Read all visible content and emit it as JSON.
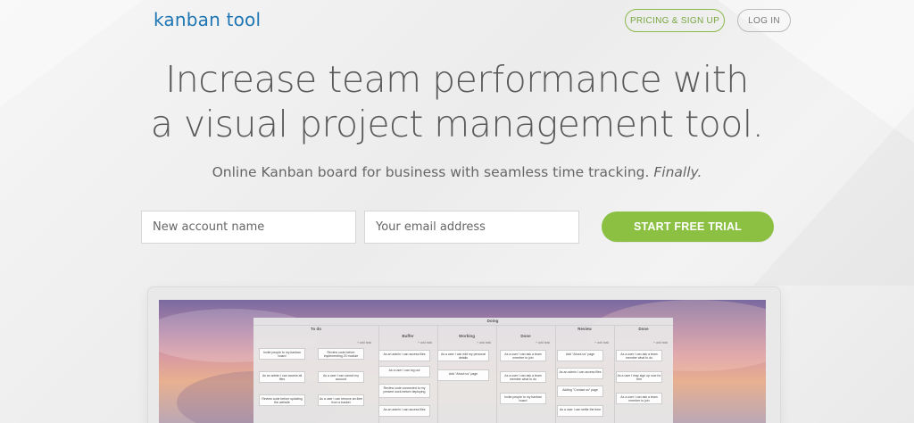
{
  "header": {
    "logo_part1": "kanban",
    "logo_part2": "tool",
    "pricing_label": "PRICING & SIGN UP",
    "login_label": "LOG IN"
  },
  "hero": {
    "headline_line1": "Increase team performance with",
    "headline_line2": "a visual project management tool.",
    "subhead_main": "Online Kanban board for business with seamless time tracking.",
    "subhead_em": "Finally."
  },
  "signup": {
    "account_placeholder": "New account name",
    "email_placeholder": "Your email address",
    "trial_label": "START FREE TRIAL"
  },
  "board": {
    "top_group": "Doing",
    "columns": [
      "To do",
      "Buffer",
      "Working",
      "Done",
      "Review",
      "Done"
    ],
    "add_task": "+ add task",
    "cards": [
      "Invite people to my kanban board",
      "Review code before implementing JS module",
      "As an admin I can access files",
      "As a user I can edit my personal details",
      "As a user I can ask a team member to join",
      "Add \"About us\" page",
      "As a user I can ask a team member what to do",
      "As an admin I can access all files",
      "As a user I can cancel my account",
      "As a user I can log out",
      "Add \"About us\" page",
      "As a user I can ask a team member what to do",
      "As an admin I can access files",
      "As a user I may sign up now for free",
      "Review code before updating the website",
      "As a user I can remove an item from a basket",
      "Review code connected to my present work before deploying",
      "Invite people to my kanban board",
      "Adding \"Contact us\" page",
      "As a user I can settle the time",
      "As a user I can ask a team member to join",
      "As an admin I can access files"
    ]
  },
  "colors": {
    "brand_blue": "#1d76b3",
    "accent_green": "#8bc043"
  }
}
